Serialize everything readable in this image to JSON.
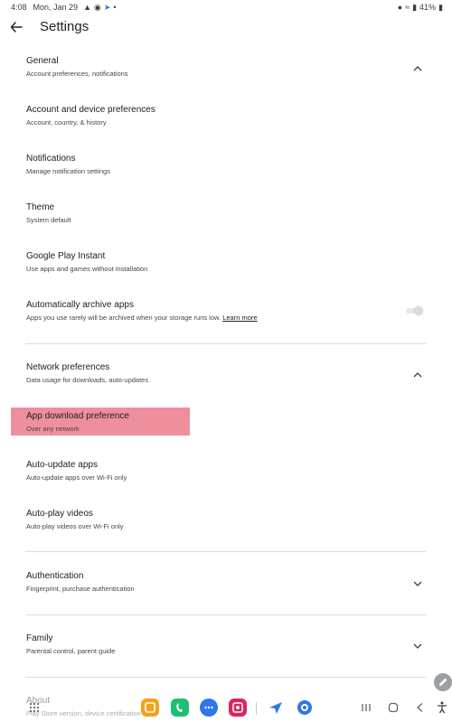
{
  "status_bar": {
    "time": "4:08",
    "date": "Mon, Jan 29",
    "left_icons": [
      "a-icon",
      "navigation-icon",
      "send-icon",
      "dot-icon"
    ],
    "battery": "41%",
    "right_icons": [
      "location-icon",
      "wifi-icon",
      "signal-icon",
      "battery-icon"
    ]
  },
  "app_bar": {
    "title": "Settings"
  },
  "sections": {
    "general": {
      "title": "General",
      "subtitle": "Account preferences, notifications",
      "expanded": true
    },
    "account": {
      "title": "Account and device preferences",
      "subtitle": "Account, country, & history"
    },
    "notifications": {
      "title": "Notifications",
      "subtitle": "Manage notification settings"
    },
    "theme": {
      "title": "Theme",
      "subtitle": "System default"
    },
    "instant": {
      "title": "Google Play Instant",
      "subtitle": "Use apps and games without installation"
    },
    "archive": {
      "title": "Automatically archive apps",
      "subtitle": "Apps you use rarely will be archived when your storage runs low.",
      "link": "Learn more",
      "enabled": false
    },
    "network": {
      "title": "Network preferences",
      "subtitle": "Data usage for downloads, auto-updates",
      "expanded": true
    },
    "app_download": {
      "title": "App download preference",
      "subtitle": "Over any network",
      "highlighted": true,
      "highlight_color": "#ea6e82"
    },
    "auto_update": {
      "title": "Auto-update apps",
      "subtitle": "Auto-update apps over Wi-Fi only"
    },
    "auto_play": {
      "title": "Auto-play videos",
      "subtitle": "Auto-play videos over Wi-Fi only"
    },
    "authentication": {
      "title": "Authentication",
      "subtitle": "Fingerprint, purchase authentication",
      "expanded": false
    },
    "family": {
      "title": "Family",
      "subtitle": "Parental control, parent guide",
      "expanded": false
    },
    "about": {
      "title": "About",
      "subtitle": "Play Store version, device certification"
    }
  },
  "dock": {
    "apps": [
      {
        "name": "notes-app-icon",
        "color": "#f4a21d"
      },
      {
        "name": "phone-app-icon",
        "color": "#1dbf73"
      },
      {
        "name": "messages-app-icon",
        "color": "#2f76e8"
      },
      {
        "name": "screen-recorder-app-icon",
        "color": "#d9265b"
      },
      {
        "name": "play-store-app-icon",
        "color": "#2f76e8"
      },
      {
        "name": "browser-app-icon",
        "color": "#2f76e8"
      }
    ],
    "nav": [
      "recent-apps-icon",
      "home-icon",
      "back-icon",
      "accessibility-icon"
    ]
  },
  "colors": {
    "accent": "#2f76e8",
    "divider": "#dadce0",
    "text_primary": "#202124",
    "text_secondary": "#444746"
  }
}
